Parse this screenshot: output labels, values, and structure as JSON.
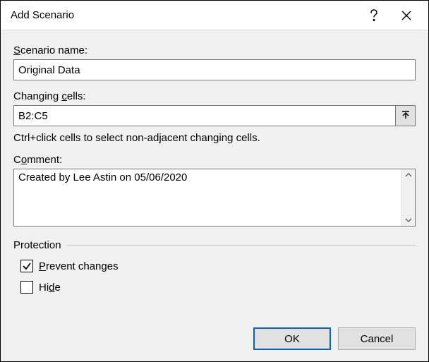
{
  "title": "Add Scenario",
  "labels": {
    "scenario_name_pre": "",
    "scenario_name_u": "S",
    "scenario_name_post": "cenario name:",
    "changing_cells_pre": "Changing ",
    "changing_cells_u": "c",
    "changing_cells_post": "ells:",
    "comment_pre": "C",
    "comment_u": "o",
    "comment_post": "mment:",
    "protection": "Protection",
    "prevent_u": "P",
    "prevent_post": "revent changes",
    "hide_pre": "Hi",
    "hide_u": "d",
    "hide_post": "e"
  },
  "values": {
    "scenario_name": "Original Data",
    "changing_cells": "B2:C5",
    "comment": "Created by Lee Astin on 05/06/2020"
  },
  "hint": "Ctrl+click cells to select non-adjacent changing cells.",
  "protection": {
    "prevent_changes": true,
    "hide": false
  },
  "buttons": {
    "ok": "OK",
    "cancel": "Cancel"
  }
}
